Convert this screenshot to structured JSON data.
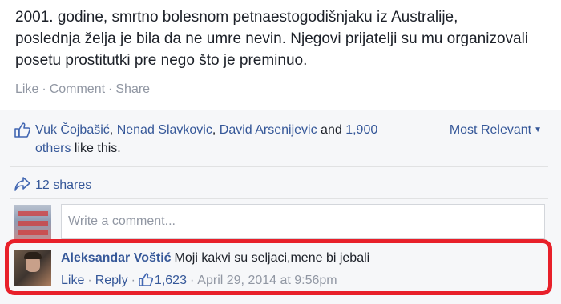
{
  "post": {
    "text_lines": [
      "2001. godine, smrtno bolesnom petnaestogodišnjaku iz Australije,",
      "poslednja želja je bila da ne umre nevin. Njegovi prijatelji su mu organizovali",
      "posetu prostitutki pre nego što je preminuo."
    ],
    "actions": {
      "like": "Like",
      "comment": "Comment",
      "share": "Share",
      "separator": "·"
    }
  },
  "likes": {
    "names": [
      "Vuk Čojbašić",
      "Nenad Slavkovic",
      "David Arsenijevic"
    ],
    "comma": ",",
    "and": "and",
    "others": "1,900 others",
    "suffix": "like this.",
    "sort_label": "Most Relevant",
    "sort_caret": "▼"
  },
  "shares": {
    "label": "12 shares"
  },
  "comment_box": {
    "placeholder": "Write a comment..."
  },
  "comment": {
    "author": "Aleksandar Voštić",
    "text": "Moji kakvi su seljaci,mene bi jebali",
    "like_label": "Like",
    "reply_label": "Reply",
    "like_count": "1,623",
    "timestamp": "April 29, 2014 at 9:56pm",
    "separator": "·"
  },
  "colors": {
    "link": "#365899",
    "meta": "#9197a3",
    "text": "#1d2129",
    "ufi_background": "#f6f7f9",
    "highlight": "#e8202a"
  },
  "icons": {
    "like": "thumbs-up-icon",
    "share": "share-arrow-icon",
    "caret": "caret-down-icon"
  }
}
